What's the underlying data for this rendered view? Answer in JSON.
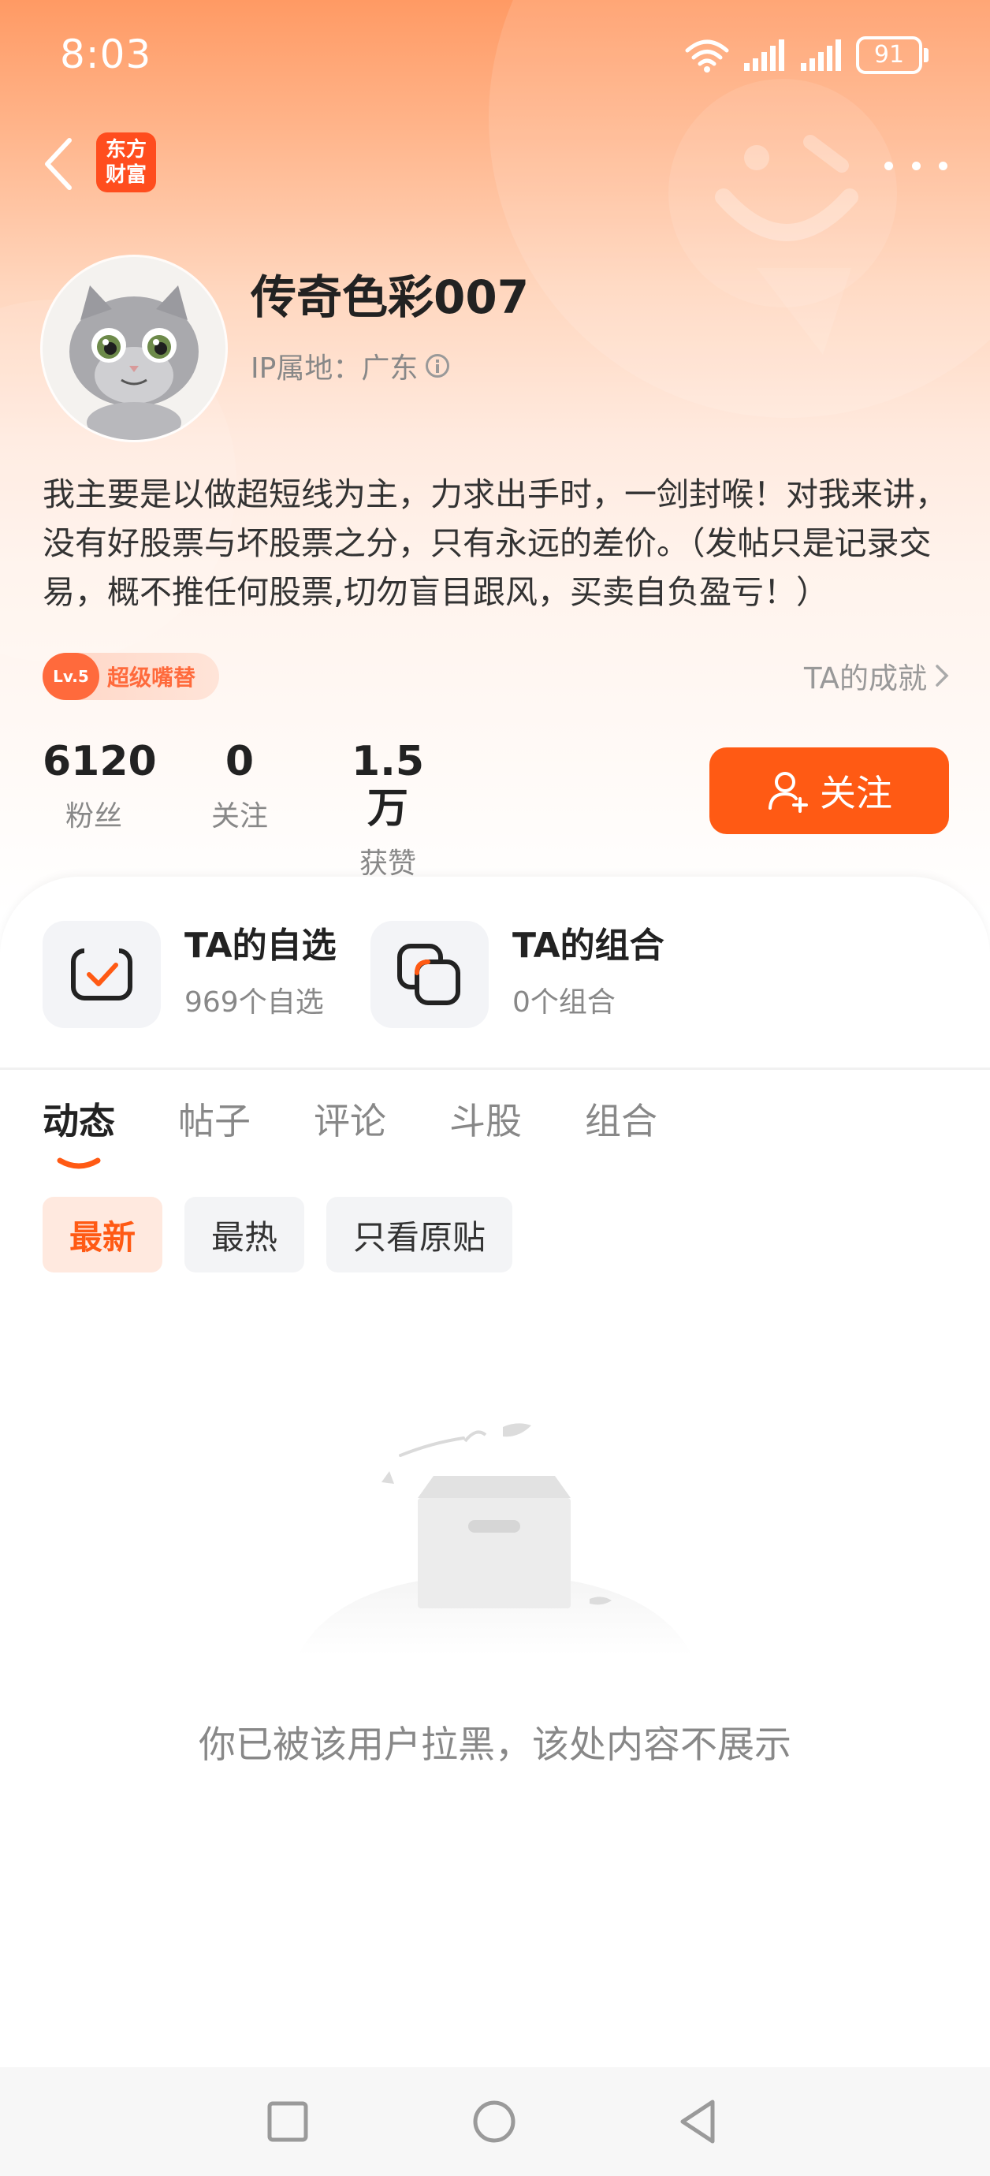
{
  "status_bar": {
    "time": "8:03",
    "battery": "91"
  },
  "header": {
    "app_logo_line1": "东方",
    "app_logo_line2": "财富"
  },
  "profile": {
    "username": "传奇色彩007",
    "ip_label": "IP属地：广东",
    "bio": "我主要是以做超短线为主，力求出手时，一剑封喉！对我来讲，没有好股票与坏股票之分，只有永远的差价。（发帖只是记录交易，概不推任何股票,切勿盲目跟风，买卖自负盈亏！）",
    "level_badge": "Lv.5",
    "level_title": "超级嘴替",
    "achievement_link": "TA的成就"
  },
  "stats": [
    {
      "value": "6120",
      "label": "粉丝"
    },
    {
      "value": "0",
      "label": "关注"
    },
    {
      "value": "1.5万",
      "label": "获赞"
    }
  ],
  "follow_button": {
    "label": "关注"
  },
  "cards": {
    "watchlist": {
      "title": "TA的自选",
      "subtitle": "969个自选"
    },
    "portfolio": {
      "title": "TA的组合",
      "subtitle": "0个组合"
    }
  },
  "tabs": [
    {
      "label": "动态",
      "active": true
    },
    {
      "label": "帖子",
      "active": false
    },
    {
      "label": "评论",
      "active": false
    },
    {
      "label": "斗股",
      "active": false
    },
    {
      "label": "组合",
      "active": false
    }
  ],
  "filters": [
    {
      "label": "最新",
      "active": true
    },
    {
      "label": "最热",
      "active": false
    },
    {
      "label": "只看原贴",
      "active": false
    }
  ],
  "empty_state": {
    "message": "你已被该用户拉黑，该处内容不展示"
  },
  "theme": {
    "accent": "#ff5a14",
    "header_gradient_top": "#ff9a64"
  }
}
